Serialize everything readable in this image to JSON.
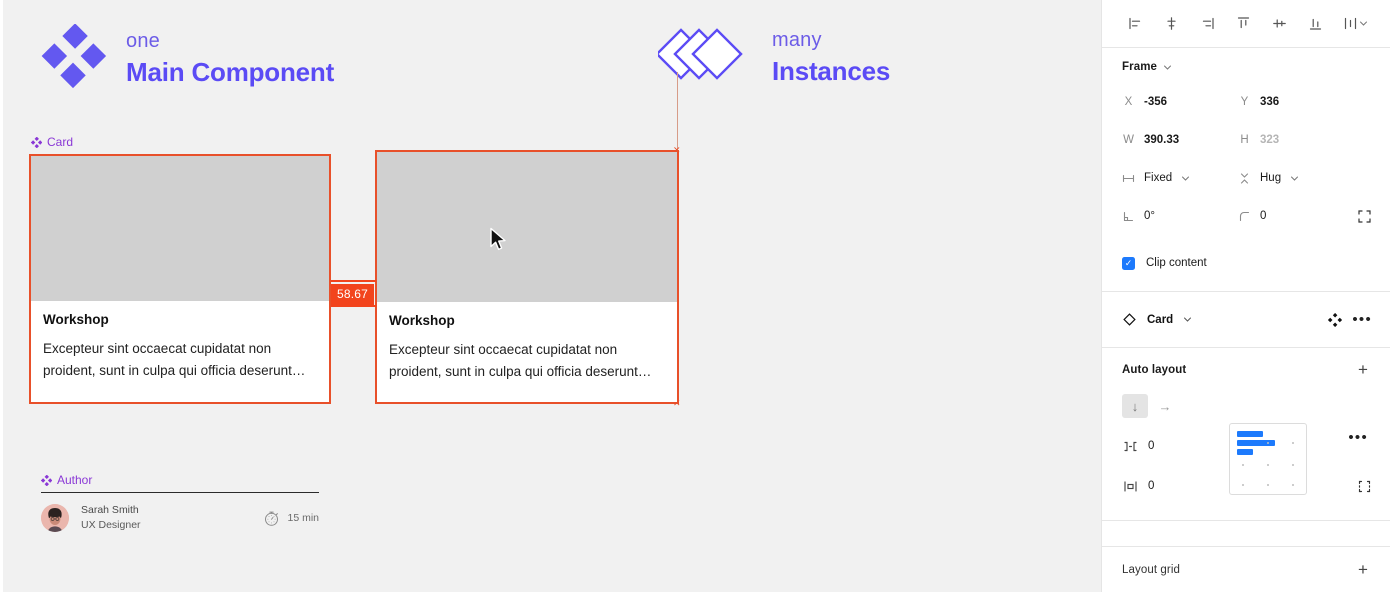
{
  "canvas": {
    "legend_one": {
      "icon": "main-component-diamond-icon",
      "kicker": "one",
      "title": "Main Component"
    },
    "legend_many": {
      "icon": "instances-stacked-diamonds-icon",
      "kicker": "many",
      "title": "Instances"
    },
    "component_label_card": "Card",
    "card_main": {
      "title": "Workshop",
      "description": "Excepteur sint occaecat cupidatat non proident, sunt in culpa qui officia deserunt…"
    },
    "card_instance": {
      "title": "Workshop",
      "description": "Excepteur sint occaecat cupidatat non proident, sunt in culpa qui officia deserunt…"
    },
    "spacing_badge": "58.67",
    "author": {
      "component_label": "Author",
      "name": "Sarah Smith",
      "role": "UX Designer",
      "duration": "15 min",
      "timer_icon": "stopwatch-icon"
    },
    "colors": {
      "selection": "#e8502a",
      "measure_badge": "#f2441d",
      "component_purple": "#8a38d6",
      "brand_indigo": "#5b4bf5",
      "media_placeholder": "#d0d0d0"
    }
  },
  "right_panel": {
    "align_tools": [
      {
        "name": "align-left-icon",
        "label": "Align left"
      },
      {
        "name": "align-horizontal-centers-icon",
        "label": "Align horizontal centers"
      },
      {
        "name": "align-right-icon",
        "label": "Align right"
      },
      {
        "name": "align-top-icon",
        "label": "Align top"
      },
      {
        "name": "align-vertical-centers-icon",
        "label": "Align vertical centers"
      },
      {
        "name": "align-bottom-icon",
        "label": "Align bottom"
      },
      {
        "name": "distribute-icon",
        "label": "Distribute"
      }
    ],
    "frame": {
      "title": "Frame",
      "x_key": "X",
      "x_value": "-356",
      "y_key": "Y",
      "y_value": "336",
      "w_key": "W",
      "w_value": "390.33",
      "h_key": "H",
      "h_value": "323",
      "horizontal_resizing": "Fixed",
      "vertical_resizing": "Hug",
      "rotation": "0°",
      "corner_radius": "0",
      "independent_corners_icon": "independent-corners-icon",
      "clip_content_label": "Clip content",
      "clip_content_checked": true
    },
    "card_instance_section": {
      "instance_icon": "instance-diamond-outline-icon",
      "name": "Card",
      "swap_icon": "swap-component-icon",
      "more_icon": "more-options-icon"
    },
    "auto_layout": {
      "title": "Auto layout",
      "add_icon": "plus-icon",
      "direction_vertical_icon": "arrow-down-icon",
      "direction_horizontal_icon": "arrow-right-icon",
      "direction_active": "vertical",
      "gap_icon": "gap-spacing-icon",
      "gap_value": "0",
      "horizontal_padding_icon": "horizontal-padding-icon",
      "horizontal_padding_value": "0",
      "vertical_padding_icon": "vertical-padding-icon",
      "vertical_padding_value": "0",
      "individual_padding_icon": "individual-padding-icon",
      "more_icon": "more-options-icon",
      "alignment_grid_selected": "top-left",
      "alignment_bars": [
        26,
        38,
        16
      ]
    },
    "layout_grid": {
      "title": "Layout grid",
      "add_icon": "plus-icon"
    }
  }
}
